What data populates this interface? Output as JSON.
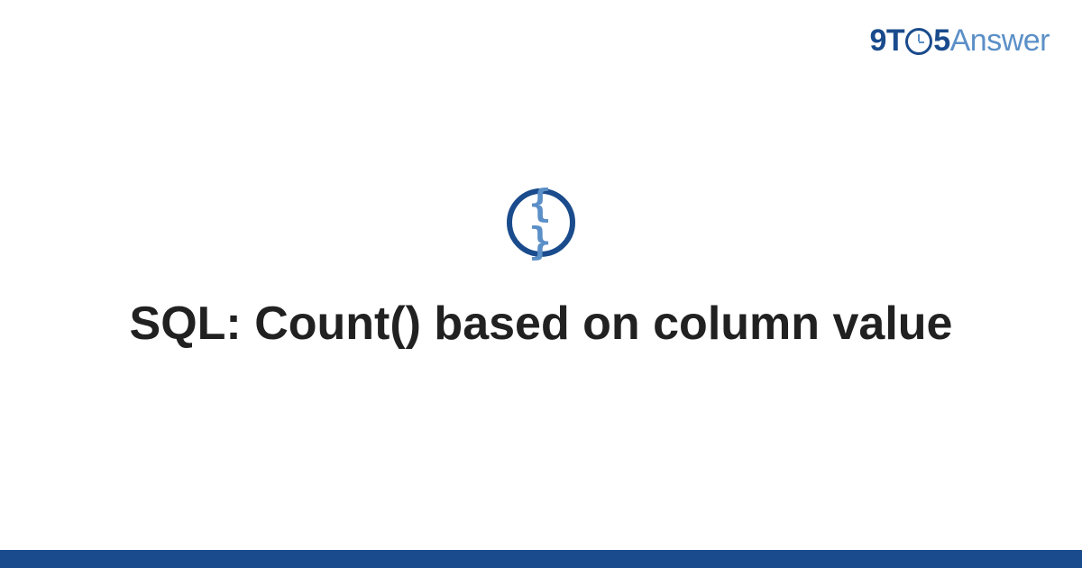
{
  "brand": {
    "part1": "9",
    "part2": "T",
    "part3": "5",
    "part4": "Answer"
  },
  "badge": {
    "icon": "{ }"
  },
  "main": {
    "title": "SQL: Count() based on column value"
  },
  "colors": {
    "primary": "#1a4b8c",
    "secondary": "#5b8fc7"
  }
}
